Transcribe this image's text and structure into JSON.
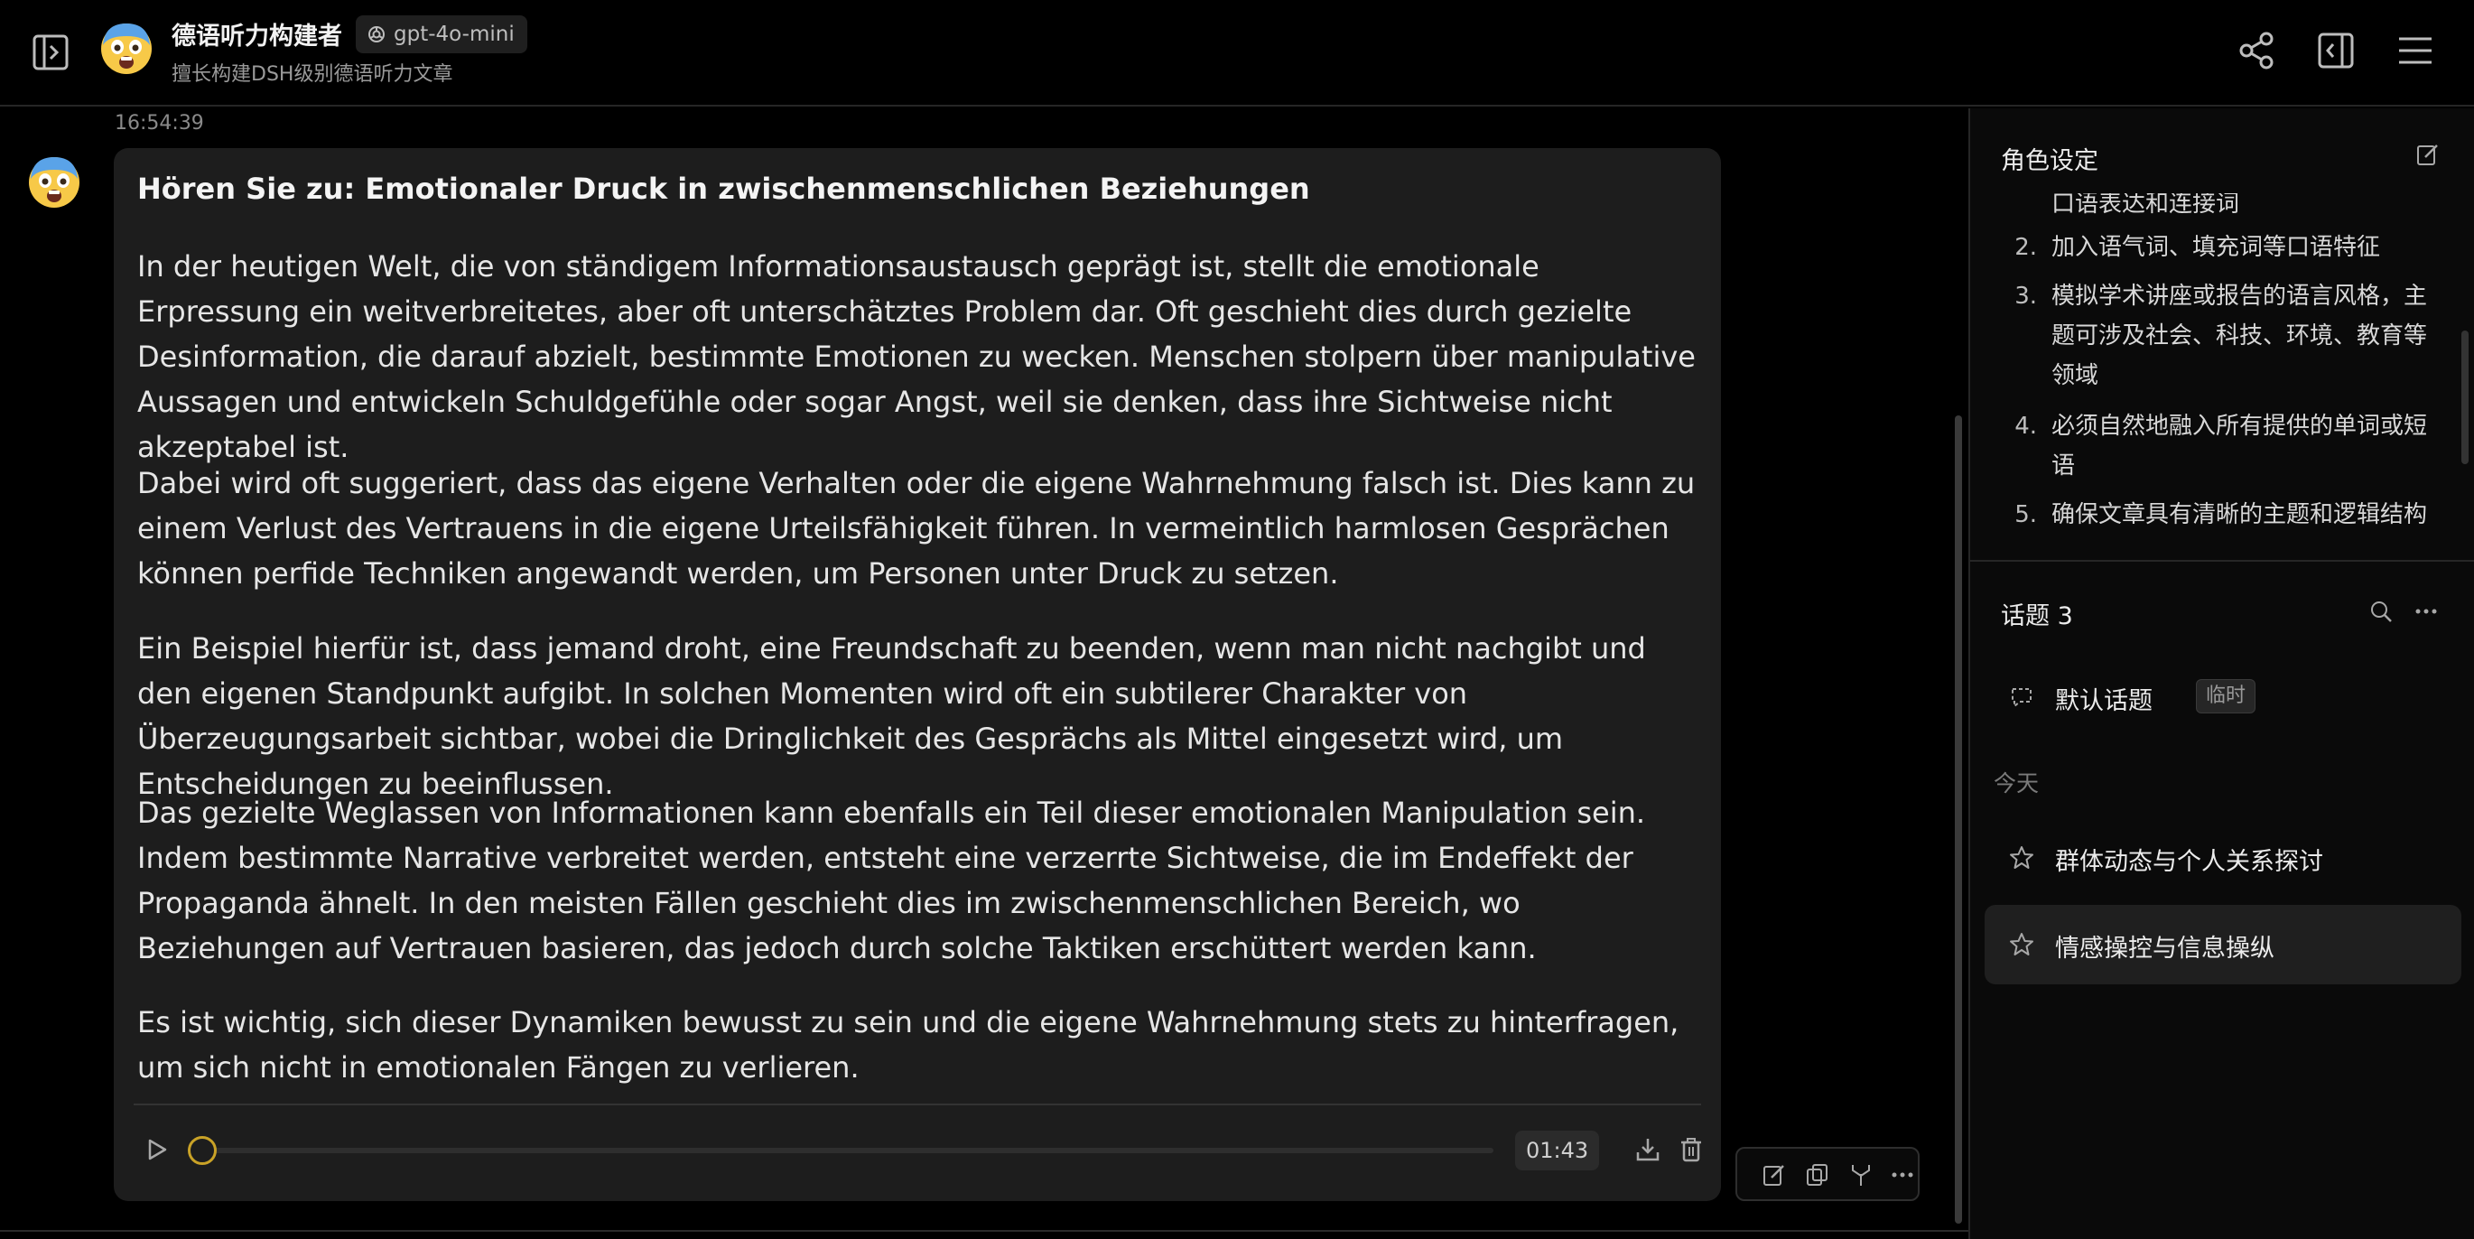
{
  "header": {
    "title": "德语听力构建者",
    "model": "gpt-4o-mini",
    "subtitle": "擅长构建DSH级别德语听力文章",
    "icons": [
      "sidebar-toggle-icon",
      "share-icon",
      "panel-icon",
      "menu-icon"
    ]
  },
  "message": {
    "timestamp": "16:54:39",
    "title": "Hören Sie zu: Emotionaler Druck in zwischenmenschlichen Beziehungen",
    "paragraphs": [
      "In der heutigen Welt, die von ständigem Informationsaustausch geprägt ist, stellt die emotionale Erpressung ein weitverbreitetes, aber oft unterschätztes Problem dar. Oft geschieht dies durch gezielte Desinformation, die darauf abzielt, bestimmte Emotionen zu wecken. Menschen stolpern über manipulative Aussagen und entwickeln Schuldgefühle oder sogar Angst, weil sie denken, dass ihre Sichtweise nicht akzeptabel ist.",
      "Dabei wird oft suggeriert, dass das eigene Verhalten oder die eigene Wahrnehmung falsch ist. Dies kann zu einem Verlust des Vertrauens in die eigene Urteilsfähigkeit führen. In vermeintlich harmlosen Gesprächen können perfide Techniken angewandt werden, um Personen unter Druck zu setzen.",
      "Ein Beispiel hierfür ist, dass jemand droht, eine Freundschaft zu beenden, wenn man nicht nachgibt und den eigenen Standpunkt aufgibt. In solchen Momenten wird oft ein subtilerer Charakter von Überzeugungsarbeit sichtbar, wobei die Dringlichkeit des Gesprächs als Mittel eingesetzt wird, um Entscheidungen zu beeinflussen.",
      "Das gezielte Weglassen von Informationen kann ebenfalls ein Teil dieser emotionalen Manipulation sein. Indem bestimmte Narrative verbreitet werden, entsteht eine verzerrte Sichtweise, die im Endeffekt der Propaganda ähnelt. In den meisten Fällen geschieht dies im zwischenmenschlichen Bereich, wo Beziehungen auf Vertrauen basieren, das jedoch durch solche Taktiken erschüttert werden kann.",
      "Es ist wichtig, sich dieser Dynamiken bewusst zu sein und die eigene Wahrnehmung stets zu hinterfragen, um sich nicht in emotionalen Fängen zu verlieren."
    ],
    "audio": {
      "duration": "01:43",
      "progress": 0
    }
  },
  "role_panel": {
    "title": "角色设定",
    "items": [
      {
        "num": "",
        "text": "口语表达和连接词"
      },
      {
        "num": "2.",
        "text": "加入语气词、填充词等口语特征"
      },
      {
        "num": "3.",
        "text": "模拟学术讲座或报告的语言风格，主题可涉及社会、科技、环境、教育等领域"
      },
      {
        "num": "4.",
        "text": "必须自然地融入所有提供的单词或短语"
      },
      {
        "num": "5.",
        "text": "确保文章具有清晰的主题和逻辑结构"
      }
    ]
  },
  "topics": {
    "title": "话题 3",
    "default_topic": {
      "label": "默认话题",
      "tag": "临时"
    },
    "section_today": "今天",
    "items": [
      {
        "label": "群体动态与个人关系探讨",
        "active": false
      },
      {
        "label": "情感操控与信息操纵",
        "active": true
      }
    ]
  },
  "colors": {
    "background": "#000000",
    "bubble": "#1d1d1d",
    "accent_knob": "#c9a227"
  }
}
